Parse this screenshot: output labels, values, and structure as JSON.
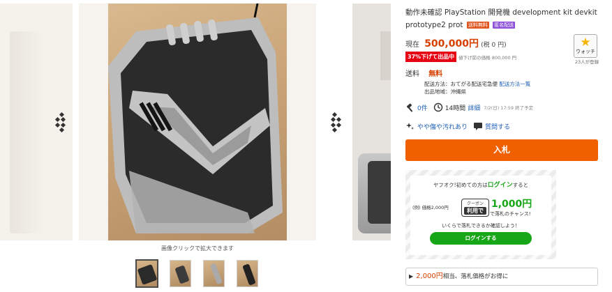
{
  "gallery": {
    "zoom_caption": "画像クリックで拡大できます",
    "thumbnail_count": 4
  },
  "item": {
    "title": "動作未確認 PlayStation 開発機 development kit devkit prototype2 prot",
    "badges": [
      "送料無料",
      "匿名配送"
    ]
  },
  "price": {
    "label": "現在",
    "value": "500,000円",
    "tax": "(税 0 円)",
    "discount_badge": "37%下げて出品中",
    "original_price": "値下げ前の価格 800,000 円"
  },
  "watch": {
    "label": "ウォッチ",
    "count": "23人が登録"
  },
  "shipping": {
    "label": "送料",
    "value": "無料",
    "method_prefix": "配送方法：おてがる配送宅急便",
    "method_link": "配送方法一覧",
    "origin": "出品地域：沖縄県"
  },
  "stats": {
    "bids": "0件",
    "time_left": "14時間",
    "detail_link": "詳細",
    "end_time": "7/2(日) 17:59 終了予定"
  },
  "condition": {
    "label": "やや傷や汚れあり",
    "question": "質問する"
  },
  "bid_button": "入札",
  "promo": {
    "line1_pre": "ヤフオク!初めての方は",
    "line1_login": "ログイン",
    "line1_post": "すると",
    "note": "(例) 価格2,000円",
    "coupon_top": "クーポン",
    "coupon_bottom": "利用で",
    "amount": "1,000円",
    "chance": "で落札のチャンス!",
    "line3": "いくらで落札できるか確認しよう！",
    "login_button": "ログインする"
  },
  "range": {
    "amount": "2,000円",
    "text": "相当、落札価格がお得に"
  },
  "colors": {
    "accent_orange": "#f06000",
    "price_red": "#d64000",
    "login_green": "#18a619",
    "link_blue": "#1f5fb8"
  }
}
